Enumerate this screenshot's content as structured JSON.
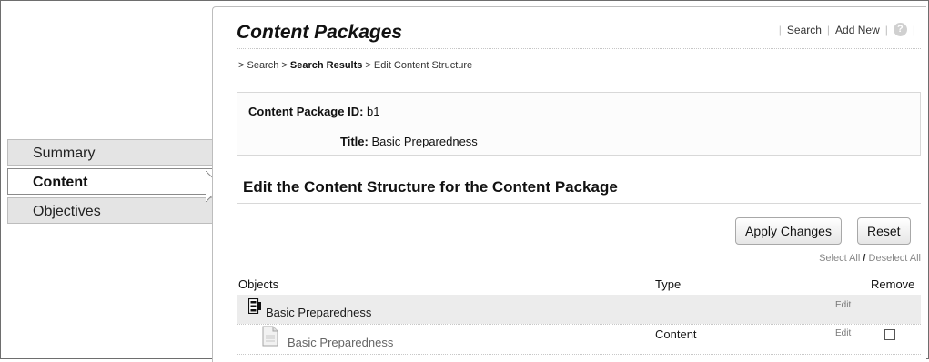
{
  "page": {
    "title": "Content Packages",
    "top_links": {
      "search": "Search",
      "add_new": "Add New"
    }
  },
  "breadcrumb": {
    "prefix": "> ",
    "search": "Search",
    "sep1": " > ",
    "results": "Search Results",
    "sep2": " > ",
    "current": "Edit Content Structure"
  },
  "package_info": {
    "id_label": "Content Package ID:",
    "id_value": "b1",
    "title_label": "Title:",
    "title_value": "Basic Preparedness"
  },
  "left_nav": {
    "items": [
      {
        "label": "Summary",
        "active": false
      },
      {
        "label": "Content",
        "active": true
      },
      {
        "label": "Objectives",
        "active": false
      }
    ]
  },
  "section": {
    "title": "Edit the Content Structure for the Content Package",
    "apply_label": "Apply Changes",
    "reset_label": "Reset",
    "select_all": "Select All",
    "slash": "/",
    "deselect_all": "Deselect All"
  },
  "grid": {
    "headers": {
      "objects": "Objects",
      "type": "Type",
      "remove": "Remove"
    },
    "rows": [
      {
        "name": "Basic Preparedness",
        "icon": "package-icon",
        "type": "",
        "edit": "Edit",
        "removable": false
      },
      {
        "name": "Basic Preparedness",
        "icon": "document-icon",
        "type": "Content",
        "edit": "Edit",
        "removable": true,
        "checked": false
      }
    ]
  }
}
